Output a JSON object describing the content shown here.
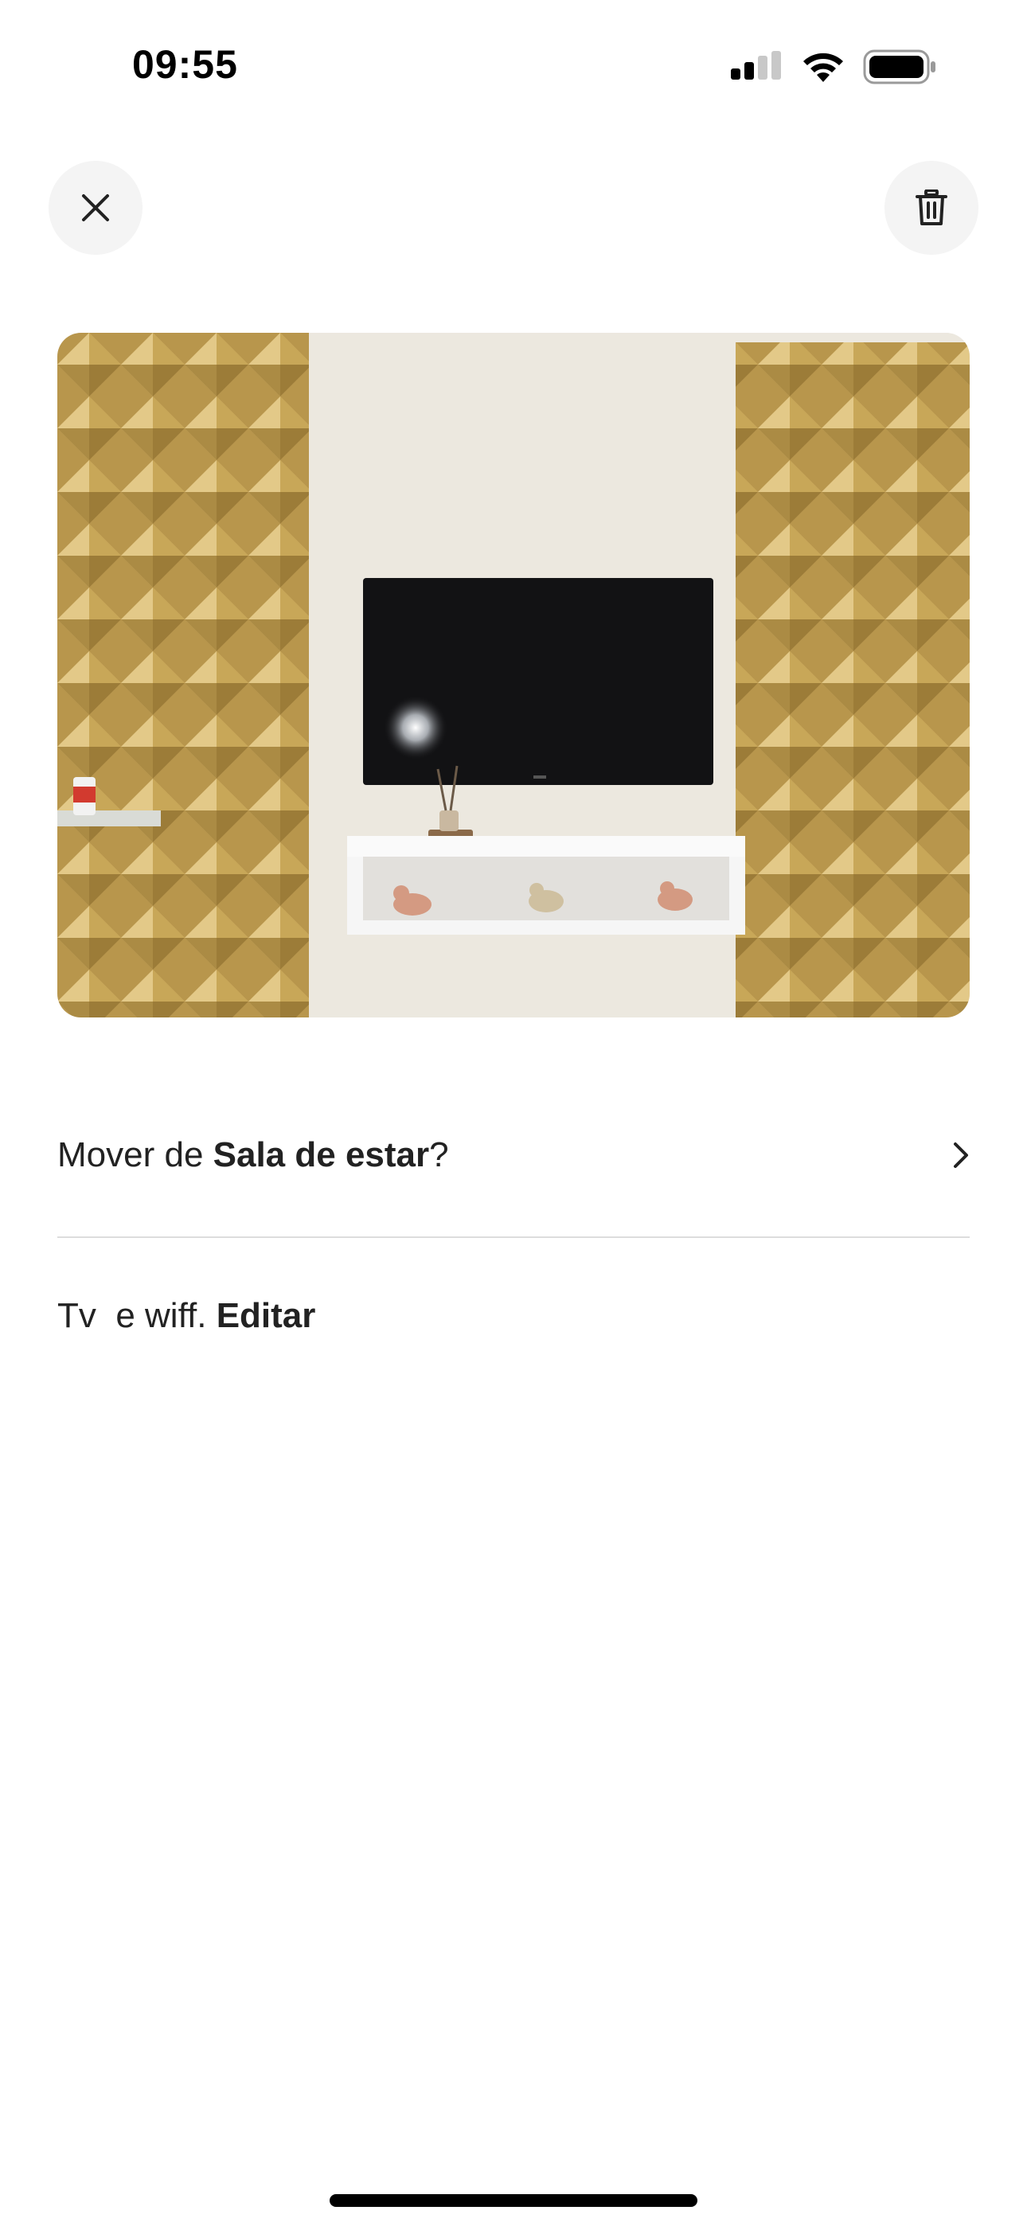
{
  "status_bar": {
    "time": "09:55"
  },
  "header": {
    "close_icon": "close-icon",
    "delete_icon": "trash-icon"
  },
  "photo": {
    "description_icon": "photo"
  },
  "move": {
    "prefix": "Mover de ",
    "room": "Sala de estar",
    "suffix": "?"
  },
  "caption": {
    "text": "Tv  e wiff. ",
    "edit_label": "Editar"
  },
  "colors": {
    "background": "#ffffff",
    "text": "#222222",
    "button_bg": "#f4f4f4",
    "divider": "#dddddd",
    "gold": "#c9a65a"
  }
}
